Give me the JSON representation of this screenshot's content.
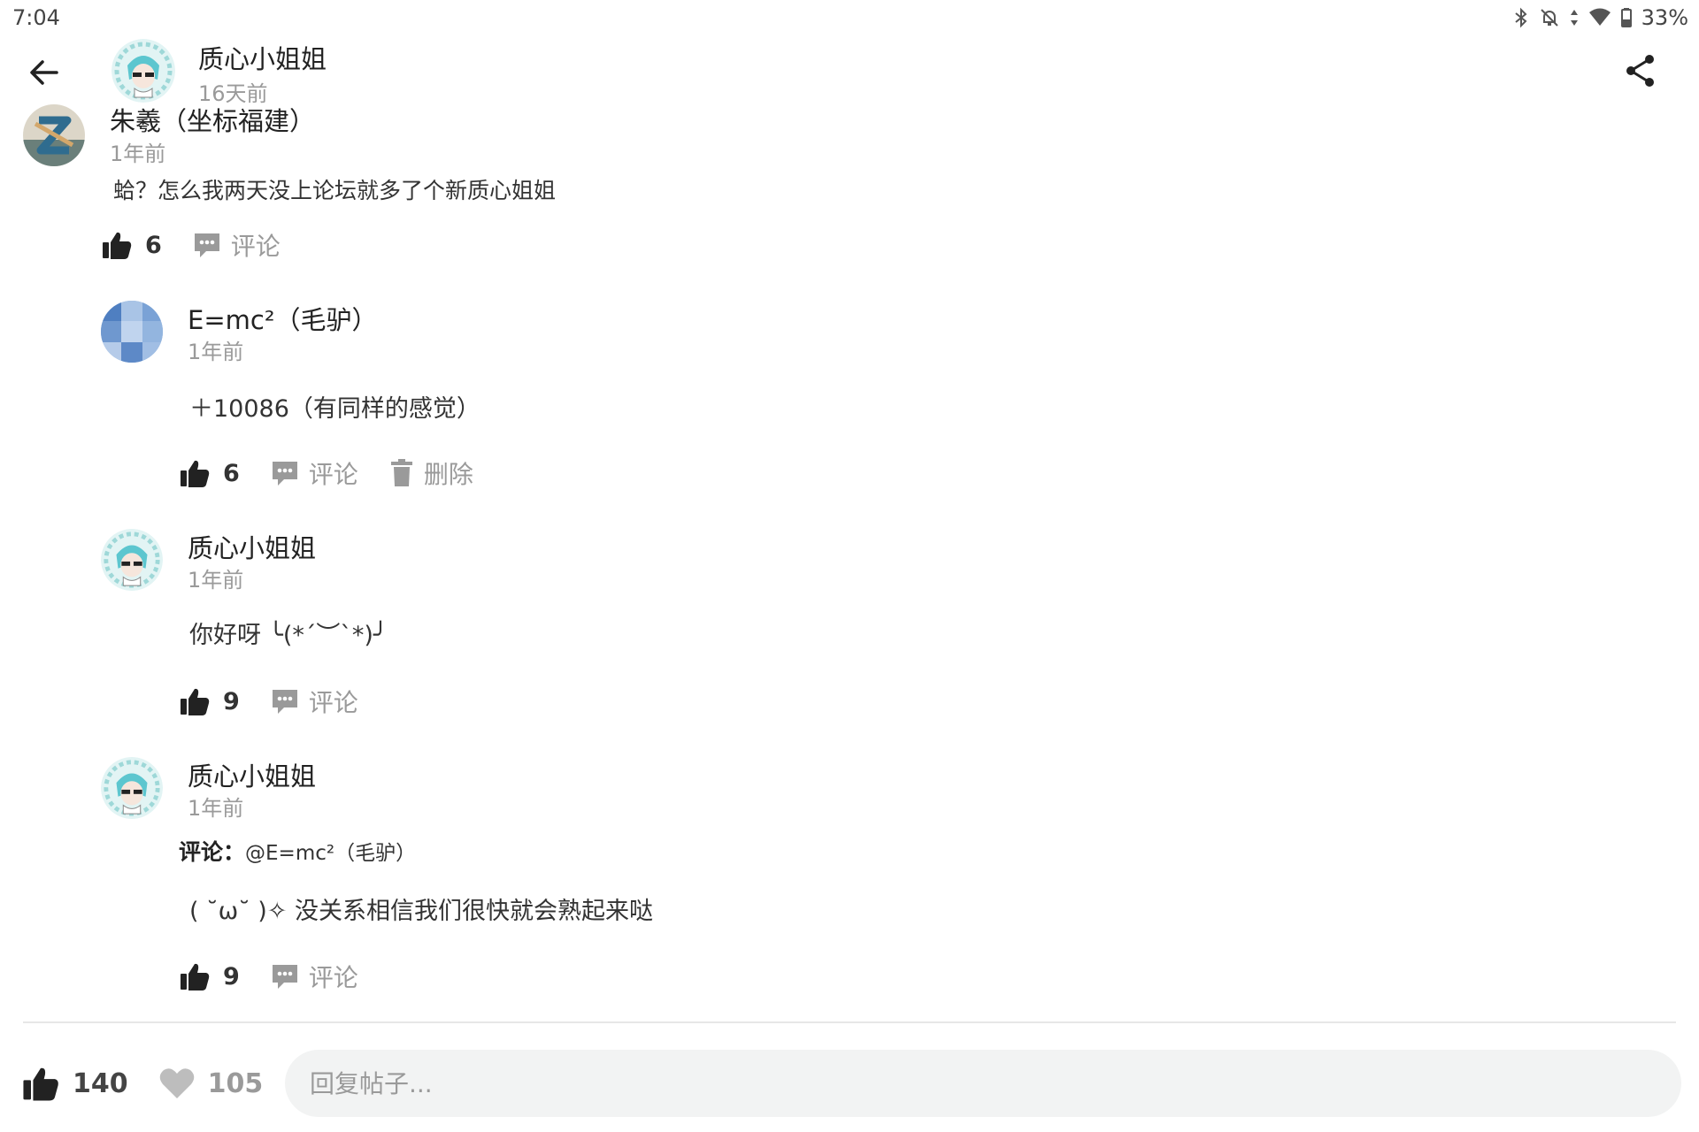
{
  "status_bar": {
    "time": "7:04",
    "battery": "33%"
  },
  "header": {
    "author": "质心小姐姐",
    "time": "16天前"
  },
  "comment": {
    "author": "朱羲（坐标福建）",
    "time": "1年前",
    "text": "蛤？怎么我两天没上论坛就多了个新质心姐姐",
    "likes": "6",
    "comment_label": "评论"
  },
  "replies": [
    {
      "author": "E=mc²（毛驴）",
      "time": "1年前",
      "text": "＋10086（有同样的感觉）",
      "likes": "6",
      "comment_label": "评论",
      "delete_label": "删除"
    },
    {
      "author": "质心小姐姐",
      "time": "1年前",
      "text": "你好呀 ╰(*´︶`*)╯",
      "likes": "9",
      "comment_label": "评论"
    },
    {
      "author": "质心小姐姐",
      "time": "1年前",
      "reply_prefix": "评论：",
      "reply_to": "@E=mc²（毛驴）",
      "text": "( ˘ω˘ )✧ 没关系相信我们很快就会熟起来哒",
      "likes": "9",
      "comment_label": "评论"
    }
  ],
  "bottom": {
    "likes": "140",
    "favorites": "105",
    "reply_placeholder": "回复帖子..."
  },
  "icons": {
    "back": "arrow-left-icon",
    "share": "share-icon",
    "like": "thumbs-up-icon",
    "comment": "comment-bubble-icon",
    "delete": "trash-icon",
    "favorite": "heart-icon"
  },
  "colors": {
    "icon_dark": "#222222",
    "icon_gray": "#9a9a9a",
    "input_bg": "#f2f3f3"
  }
}
